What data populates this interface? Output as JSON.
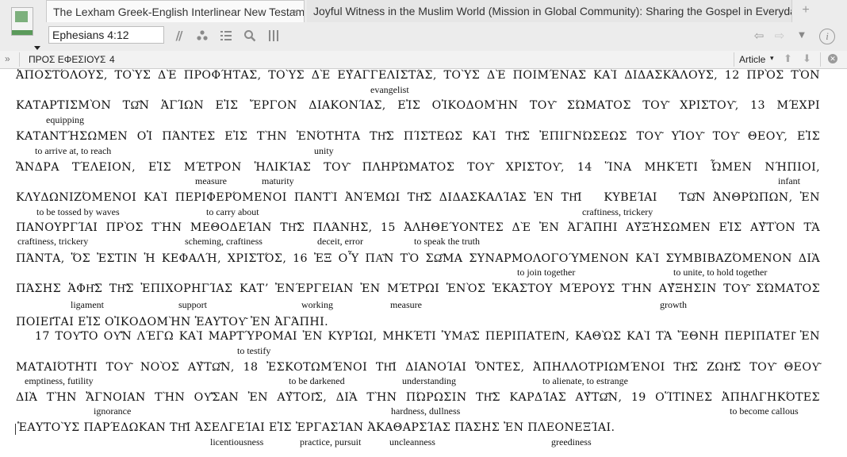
{
  "tabs": [
    {
      "label": "The Lexham Greek-English Interlinear New Testament",
      "active": true,
      "close": "×"
    },
    {
      "label": "Joyful Witness in the Muslim World (Mission in Global Community): Sharing the Gospel in Everyday Encounters",
      "active": false
    }
  ],
  "tab_add": "+",
  "toolbar": {
    "reference": "Ephesians 4:12",
    "icons": [
      "parallel-icon",
      "visual-filter-icon",
      "text-layout-icon",
      "search-icon",
      "columns-icon"
    ],
    "right_icons": [
      "back-arrow-icon",
      "forward-arrow-icon",
      "history-dropdown-icon",
      "info-icon"
    ]
  },
  "breadcrumb": {
    "toggle": "»",
    "book": "ΠΡΟΣ ΕΦΕΣΙΟΥΣ",
    "separator": "›",
    "chapter": "4",
    "view": "Article",
    "view_caret": "▾"
  },
  "lines": [
    "ἀποστόλους, τοὺς δὲ προφήτας, τοὺς δὲ εὐαγγελιστάς, τοὺς δὲ ποιμένας καὶ διδασκάλους, 12 πρὸς τὸν",
    "καταρτισμὸν τῶν ἁγίων εἰς ἔργον διακονίας, εἰς οἰκοδομὴν τοῦ σώματος τοῦ Χριστοῦ, 13 μέχρι",
    "καταντήσωμεν οἱ πάντες εἰς τὴν ἑνότητα τῆς πίστεως καὶ τῆς ἐπιγνώσεως τοῦ υἱοῦ τοῦ θεοῦ, εἰς",
    "ἄνδρα τέλειον, εἰς μέτρον ἡλικίας τοῦ πληρώματος τοῦ Χριστοῦ, 14 ἵνα μηκέτι ὦμεν νήπιοι,",
    "κλυδωνιζόμενοι καὶ περιφερόμενοι παντὶ ἀνέμῳ τῆς διδασκαλίας ἐν τῇ   κυβείᾳ   τῶν ἀνθρώπων, ἐν",
    "πανουργίᾳ πρὸς τὴν μεθοδείαν τῆς πλάνης, 15 ἀληθεύοντες δὲ ἐν ἀγάπῃ αὐξήσωμεν εἰς αὐτὸν τὰ",
    "πάντα, ὅς ἐστιν ἡ κεφαλή, Χριστός, 16 ἐξ οὗ πᾶν τὸ σῶμα συναρμολογούμενον καὶ συμβιβαζόμενον διὰ",
    "πάσης ἁφῆς τῆς ἐπιχορηγίας κατʼ ἐνέργειαν ἐν μέτρῳ ἑνὸς ἑκάστου μέρους τὴν αὔξησιν τοῦ σώματος",
    "ποιεῖται εἰς οἰκοδομὴν ἑαυτοῦ ἐν ἀγάπῃ.",
    "17 τοῦτο οὖν λέγω καὶ μαρτύρομαι ἐν κυρίῳ, μηκέτι ὑμᾶς περιπατεῖν, καθὼς καὶ τὰ ἔθνη περιπατεῖ ἐν",
    "ματαιότητι τοῦ νοὸς αὐτῶν, 18 ἐσκοτωμένοι τῇ διανοίᾳ ὄντες, ἀπηλλοτριωμένοι τῆς ζωῆς τοῦ θεοῦ",
    "διὰ τὴν ἄγνοιαν τὴν οὖσαν ἐν αὐτοῖς, διὰ τὴν πώρωσιν τῆς καρδίας αὐτῶν, 19 οἵτινες ἀπηλγηκότες",
    "ἑαυτοὺς παρέδωκαν τῇ ἀσελγείᾳ εἰς ἐργασίαν ἀκαθαρσίας πάσης ἐν πλεονεξίᾳ."
  ],
  "glosses": [
    "evangelist",
    "equipping",
    "to arrive at, to reach",
    "unity",
    "measure",
    "maturity",
    "infant",
    "to be tossed by waves",
    "to carry about",
    "craftiness, trickery",
    "craftiness, trickery",
    "scheming, craftiness",
    "deceit, error",
    "to speak the truth",
    "to join together",
    "to unite, to hold together",
    "ligament",
    "support",
    "working",
    "measure",
    "growth",
    "to testify",
    "emptiness, futility",
    "to be darkened",
    "understanding",
    "to alienate, to estrange",
    "ignorance",
    "hardness, dullness",
    "to become callous",
    "licentiousness",
    "practice, pursuit",
    "uncleanness",
    "greediness"
  ],
  "colors": {
    "chrome": "#ececec",
    "text": "#111111",
    "tab_active": "#fafafa"
  }
}
